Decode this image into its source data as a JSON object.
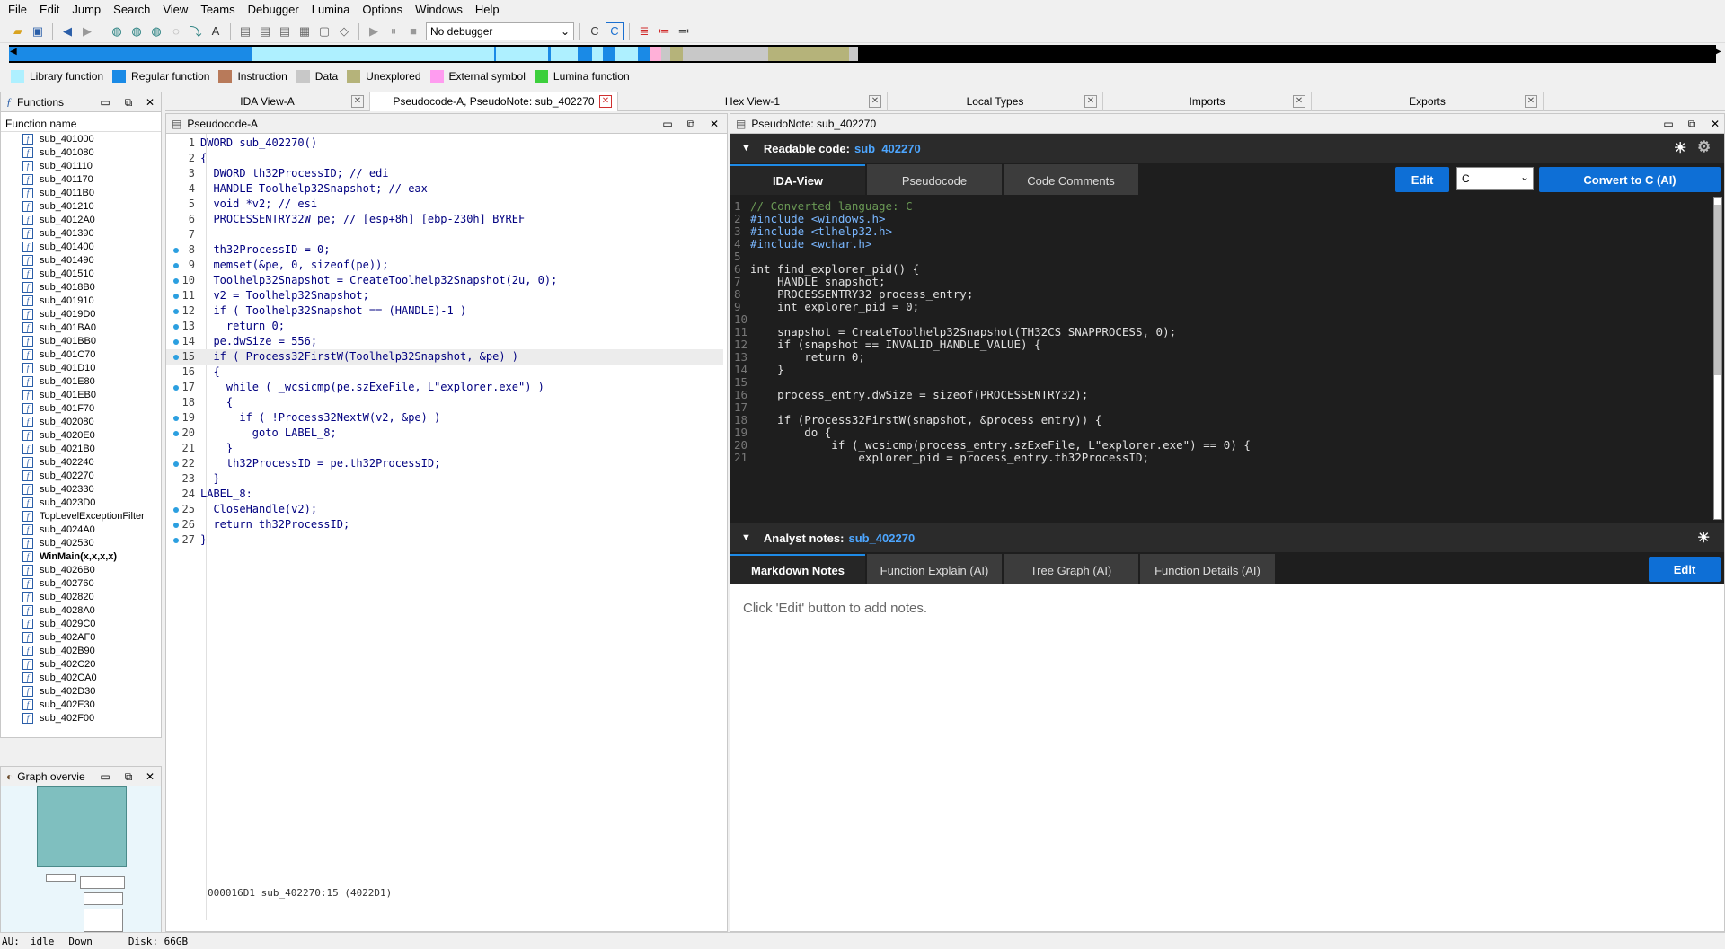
{
  "menu": [
    "File",
    "Edit",
    "Jump",
    "Search",
    "View",
    "Teams",
    "Debugger",
    "Lumina",
    "Options",
    "Windows",
    "Help"
  ],
  "toolbar": {
    "debugger_select": "No debugger"
  },
  "legend": [
    {
      "label": "Library function",
      "color": "#aef0ff"
    },
    {
      "label": "Regular function",
      "color": "#1a8ae6"
    },
    {
      "label": "Instruction",
      "color": "#b87a5a"
    },
    {
      "label": "Data",
      "color": "#c8c8c8"
    },
    {
      "label": "Unexplored",
      "color": "#b5b37a"
    },
    {
      "label": "External symbol",
      "color": "#ff9cf0"
    },
    {
      "label": "Lumina function",
      "color": "#3ccf3c"
    }
  ],
  "functions_panel": {
    "title": "Functions",
    "column": "Function name",
    "items": [
      "sub_401000",
      "sub_401080",
      "sub_401110",
      "sub_401170",
      "sub_4011B0",
      "sub_401210",
      "sub_4012A0",
      "sub_401390",
      "sub_401400",
      "sub_401490",
      "sub_401510",
      "sub_4018B0",
      "sub_401910",
      "sub_4019D0",
      "sub_401BA0",
      "sub_401BB0",
      "sub_401C70",
      "sub_401D10",
      "sub_401E80",
      "sub_401EB0",
      "sub_401F70",
      "sub_402080",
      "sub_4020E0",
      "sub_4021B0",
      "sub_402240",
      "sub_402270",
      "sub_402330",
      "sub_4023D0",
      "TopLevelExceptionFilter",
      "sub_4024A0",
      "sub_402530",
      "WinMain(x,x,x,x)",
      "sub_4026B0",
      "sub_402760",
      "sub_402820",
      "sub_4028A0",
      "sub_4029C0",
      "sub_402AF0",
      "sub_402B90",
      "sub_402C20",
      "sub_402CA0",
      "sub_402D30",
      "sub_402E30",
      "sub_402F00"
    ]
  },
  "graph_overview": {
    "title": "Graph overvie"
  },
  "tabs": [
    {
      "label": "IDA View-A"
    },
    {
      "label": "Pseudocode-A, PseudoNote: sub_402270"
    },
    {
      "label": "Hex View-1"
    },
    {
      "label": "Local Types"
    },
    {
      "label": "Imports"
    },
    {
      "label": "Exports"
    }
  ],
  "pseudocode": {
    "title": "Pseudocode-A",
    "lines": [
      {
        "n": "1",
        "dot": false,
        "t": "DWORD sub_402270()"
      },
      {
        "n": "2",
        "dot": false,
        "t": "{"
      },
      {
        "n": "3",
        "dot": false,
        "t": "  DWORD th32ProcessID; // edi"
      },
      {
        "n": "4",
        "dot": false,
        "t": "  HANDLE Toolhelp32Snapshot; // eax"
      },
      {
        "n": "5",
        "dot": false,
        "t": "  void *v2; // esi"
      },
      {
        "n": "6",
        "dot": false,
        "t": "  PROCESSENTRY32W pe; // [esp+8h] [ebp-230h] BYREF"
      },
      {
        "n": "7",
        "dot": false,
        "t": ""
      },
      {
        "n": "8",
        "dot": true,
        "t": "  th32ProcessID = 0;"
      },
      {
        "n": "9",
        "dot": true,
        "t": "  memset(&pe, 0, sizeof(pe));"
      },
      {
        "n": "10",
        "dot": true,
        "t": "  Toolhelp32Snapshot = CreateToolhelp32Snapshot(2u, 0);"
      },
      {
        "n": "11",
        "dot": true,
        "t": "  v2 = Toolhelp32Snapshot;"
      },
      {
        "n": "12",
        "dot": true,
        "t": "  if ( Toolhelp32Snapshot == (HANDLE)-1 )"
      },
      {
        "n": "13",
        "dot": true,
        "t": "    return 0;"
      },
      {
        "n": "14",
        "dot": true,
        "t": "  pe.dwSize = 556;"
      },
      {
        "n": "15",
        "dot": true,
        "t": "  if ( Process32FirstW(Toolhelp32Snapshot, &pe) )"
      },
      {
        "n": "16",
        "dot": false,
        "t": "  {"
      },
      {
        "n": "17",
        "dot": true,
        "t": "    while ( _wcsicmp(pe.szExeFile, L\"explorer.exe\") )"
      },
      {
        "n": "18",
        "dot": false,
        "t": "    {"
      },
      {
        "n": "19",
        "dot": true,
        "t": "      if ( !Process32NextW(v2, &pe) )"
      },
      {
        "n": "20",
        "dot": true,
        "t": "        goto LABEL_8;"
      },
      {
        "n": "21",
        "dot": false,
        "t": "    }"
      },
      {
        "n": "22",
        "dot": true,
        "t": "    th32ProcessID = pe.th32ProcessID;"
      },
      {
        "n": "23",
        "dot": false,
        "t": "  }"
      },
      {
        "n": "24",
        "dot": false,
        "t": "LABEL_8:"
      },
      {
        "n": "25",
        "dot": true,
        "t": "  CloseHandle(v2);"
      },
      {
        "n": "26",
        "dot": true,
        "t": "  return th32ProcessID;"
      },
      {
        "n": "27",
        "dot": true,
        "t": "}"
      }
    ],
    "status": "000016D1 sub_402270:15 (4022D1)"
  },
  "pseudonote": {
    "title": "PseudoNote: sub_402270",
    "readable_label": "Readable code:",
    "readable_fn": "sub_402270",
    "subtabs": [
      "IDA-View",
      "Pseudocode",
      "Code Comments"
    ],
    "edit_label": "Edit",
    "lang_value": "C",
    "convert_label": "Convert to C (AI)",
    "code": [
      {
        "n": "1",
        "t": "// Converted language: C"
      },
      {
        "n": "2",
        "t": "#include <windows.h>"
      },
      {
        "n": "3",
        "t": "#include <tlhelp32.h>"
      },
      {
        "n": "4",
        "t": "#include <wchar.h>"
      },
      {
        "n": "5",
        "t": ""
      },
      {
        "n": "6",
        "t": "int find_explorer_pid() {"
      },
      {
        "n": "7",
        "t": "    HANDLE snapshot;"
      },
      {
        "n": "8",
        "t": "    PROCESSENTRY32 process_entry;"
      },
      {
        "n": "9",
        "t": "    int explorer_pid = 0;"
      },
      {
        "n": "10",
        "t": ""
      },
      {
        "n": "11",
        "t": "    snapshot = CreateToolhelp32Snapshot(TH32CS_SNAPPROCESS, 0);"
      },
      {
        "n": "12",
        "t": "    if (snapshot == INVALID_HANDLE_VALUE) {"
      },
      {
        "n": "13",
        "t": "        return 0;"
      },
      {
        "n": "14",
        "t": "    }"
      },
      {
        "n": "15",
        "t": ""
      },
      {
        "n": "16",
        "t": "    process_entry.dwSize = sizeof(PROCESSENTRY32);"
      },
      {
        "n": "17",
        "t": ""
      },
      {
        "n": "18",
        "t": "    if (Process32FirstW(snapshot, &process_entry)) {"
      },
      {
        "n": "19",
        "t": "        do {"
      },
      {
        "n": "20",
        "t": "            if (_wcsicmp(process_entry.szExeFile, L\"explorer.exe\") == 0) {"
      },
      {
        "n": "21",
        "t": "                explorer_pid = process_entry.th32ProcessID;"
      }
    ],
    "notes_label": "Analyst notes:",
    "notes_fn": "sub_402270",
    "notes_tabs": [
      "Markdown Notes",
      "Function Explain (AI)",
      "Tree Graph (AI)",
      "Function Details (AI)"
    ],
    "notes_edit": "Edit",
    "notes_placeholder": "Click 'Edit' button to add notes."
  },
  "status": {
    "au": "AU:",
    "state": "idle",
    "dir": "Down",
    "disk": "Disk: 66GB"
  }
}
